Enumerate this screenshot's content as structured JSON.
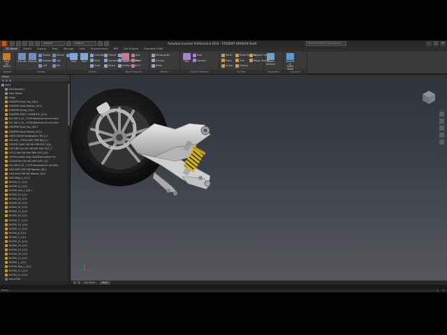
{
  "title_bar": {
    "title": "Autodesk Inventor Professional 2016 - STUDENT VERSION   Shaft",
    "project_select": "Generic",
    "view_select": "Default",
    "search_placeholder": "Search Help & Commands...",
    "controls": [
      "–",
      "□",
      "×"
    ]
  },
  "ribbon_tabs": [
    "3D Model",
    "Sketch",
    "Inspect",
    "Tools",
    "Manage",
    "View",
    "Environments",
    "BIM",
    "Get Started",
    "Autodesk A360"
  ],
  "ribbon_active_tab": 0,
  "ribbon_panels": [
    {
      "title": "Sketch",
      "big": [
        "Start 2D Sketch"
      ],
      "small": []
    },
    {
      "title": "Create",
      "big": [
        "Extrude",
        "Revolve"
      ],
      "small": [
        "Sweep",
        "Emboss",
        "Loft",
        "Derive",
        "Coil",
        "Rib",
        "Import"
      ]
    },
    {
      "title": "Modify",
      "big": [
        "Hole",
        "Fillet"
      ],
      "small": [
        "Chamfer",
        "Shell",
        "Draft",
        "Thread",
        "Combine",
        "Direct",
        "Split",
        "Thicken/ Offset",
        "Delete Face"
      ]
    },
    {
      "title": "Work Features",
      "big": [
        "Plane"
      ],
      "small": [
        "Axis",
        "Point",
        "UCS"
      ]
    },
    {
      "title": "Pattern",
      "big": [],
      "small": [
        "Rectangular",
        "Circular",
        "Mirror"
      ]
    },
    {
      "title": "Create Freeform",
      "big": [
        "Box"
      ],
      "small": [
        "Face",
        "Convert"
      ]
    },
    {
      "title": "Surface",
      "big": [],
      "small": [
        "Stitch",
        "Patch",
        "Sculpt",
        "Ruled Surface",
        "Trim",
        "Extend",
        "Replace Face",
        "Repair Bodies"
      ]
    },
    {
      "title": "Simulation",
      "big": [
        "Shape Analysis"
      ],
      "small": []
    },
    {
      "title": "Convert",
      "big": [
        "Convert to Sheet Metal"
      ],
      "small": []
    }
  ],
  "browser": {
    "title": "Model",
    "nodes": [
      {
        "label": "Part1",
        "icon": "root",
        "indent": 0
      },
      {
        "label": "Solid Bodies(1)",
        "icon": "folder",
        "indent": 1
      },
      {
        "label": "View: Master",
        "icon": "folder",
        "indent": 1
      },
      {
        "label": "Origin",
        "icon": "folder",
        "indent": 1
      },
      {
        "label": "2000RPM Shock Top_1(9):1",
        "icon": "part",
        "indent": 1
      },
      {
        "label": "2000RPM Shock Bottom_1(9):1",
        "icon": "part",
        "indent": 1
      },
      {
        "label": "2000RPM Spring_1(9):1",
        "icon": "part",
        "indent": 1
      },
      {
        "label": "2000RPM STRUT_10REMOTE_1(9):1",
        "icon": "part",
        "indent": 1
      },
      {
        "label": "M12 DIN 9_15_ 17476 Kombinat mit mit mitte",
        "icon": "part",
        "indent": 1
      },
      {
        "label": "M12 DIN 9_15_ 17476 Kombinat mit mit mitte",
        "icon": "part",
        "indent": 1
      },
      {
        "label": "2000RPM Shock top_1(9):1",
        "icon": "part",
        "indent": 1
      },
      {
        "label": "2000RPM Shock Bottom_1(9):1",
        "icon": "part",
        "indent": 1
      },
      {
        "label": "13000 DIN 66 Kombination HFR_0_1",
        "icon": "part",
        "indent": 1
      },
      {
        "label": "SAE Axle_ 13000 ANSI 7986 (B)(1)_1",
        "icon": "part",
        "indent": 1
      },
      {
        "label": "12000SC Swift_SAE 98 1998 2037_8(1)",
        "icon": "part",
        "indent": 1
      },
      {
        "label": "115(1)NH Nut SAE 5W1500 SAE 2037_1",
        "icon": "part",
        "indent": 1
      },
      {
        "label": "1151(1)Nut DIN Half SWH-2037_4(1)",
        "icon": "part",
        "indent": 1
      },
      {
        "label": "126700 washer plate SAE(Steel washer Pro",
        "icon": "part",
        "indent": 1
      },
      {
        "label": "1151NH Nut SAE 98 1998 2037_1(1)",
        "icon": "part",
        "indent": 1
      },
      {
        "label": "M12 DIN 9_15_ 17476 Kombinat mit mit mitte",
        "icon": "part",
        "indent": 1
      },
      {
        "label": "1000-6000 SAE SWP Washer_18(1)",
        "icon": "part",
        "indent": 1
      },
      {
        "label": "1000-4000 DIN SAE Washer_14(1)",
        "icon": "part",
        "indent": 1
      },
      {
        "label": "1000-5Bag_1_2(1)1",
        "icon": "part",
        "indent": 1
      },
      {
        "label": "5k2500_21_1(1)1",
        "icon": "part",
        "indent": 1
      },
      {
        "label": "5k2500_12_1(1)1",
        "icon": "part",
        "indent": 1
      },
      {
        "label": "5k2500_rear_1_1(9):1",
        "icon": "part",
        "indent": 1
      },
      {
        "label": "5k2500_23_1(1)1",
        "icon": "part",
        "indent": 1
      },
      {
        "label": "5k2500_06_1(1)1",
        "icon": "part",
        "indent": 1
      },
      {
        "label": "5k2500_05_1(1)1",
        "icon": "part",
        "indent": 1
      },
      {
        "label": "5k2500_02_1(1)1",
        "icon": "part",
        "indent": 1
      },
      {
        "label": "5k2500_13_1(1)1",
        "icon": "part",
        "indent": 1
      },
      {
        "label": "5k2500_16_1(1)1",
        "icon": "part",
        "indent": 1
      },
      {
        "label": "5k2500_17_1(1)1",
        "icon": "part",
        "indent": 1
      },
      {
        "label": "5k2500_14_1(1)1",
        "icon": "part",
        "indent": 1
      },
      {
        "label": "5k2500_15_1(1)1",
        "icon": "part",
        "indent": 1
      },
      {
        "label": "5k2500_8_1(1)1",
        "icon": "part",
        "indent": 1
      },
      {
        "label": "5k2500_7_1(1)1",
        "icon": "part",
        "indent": 1
      },
      {
        "label": "5k2500_22_1(1)1",
        "icon": "part",
        "indent": 1
      },
      {
        "label": "5k2500_19_1(1)1",
        "icon": "part",
        "indent": 1
      },
      {
        "label": "5k2500_20_1(1)1",
        "icon": "part",
        "indent": 1
      },
      {
        "label": "5k2500_18_1(1)1",
        "icon": "part",
        "indent": 1
      },
      {
        "label": "5k2500_10_1(1)1",
        "icon": "part",
        "indent": 1
      },
      {
        "label": "5k2500_1_1(1)1",
        "icon": "part",
        "indent": 1
      },
      {
        "label": "5k2500_Bag_1_3(1)1",
        "icon": "part",
        "indent": 1
      },
      {
        "label": "5k2500_11_1(1)1",
        "icon": "part",
        "indent": 1
      },
      {
        "label": "5k2500_12_1(1)1",
        "icon": "part",
        "indent": 1
      },
      {
        "label": "End of Part",
        "icon": "rel",
        "indent": 1
      }
    ]
  },
  "doc_tabs": [
    "My Home",
    "Part1"
  ],
  "doc_active_tab": 1,
  "status": {
    "left": "Ready",
    "right": [
      "1",
      "1"
    ]
  },
  "colors": {
    "accent": "#b8602a",
    "part_icon": "#c89a28",
    "spring": "#d8b41a",
    "frame": "#c9c9c9",
    "tire": "#151515"
  }
}
